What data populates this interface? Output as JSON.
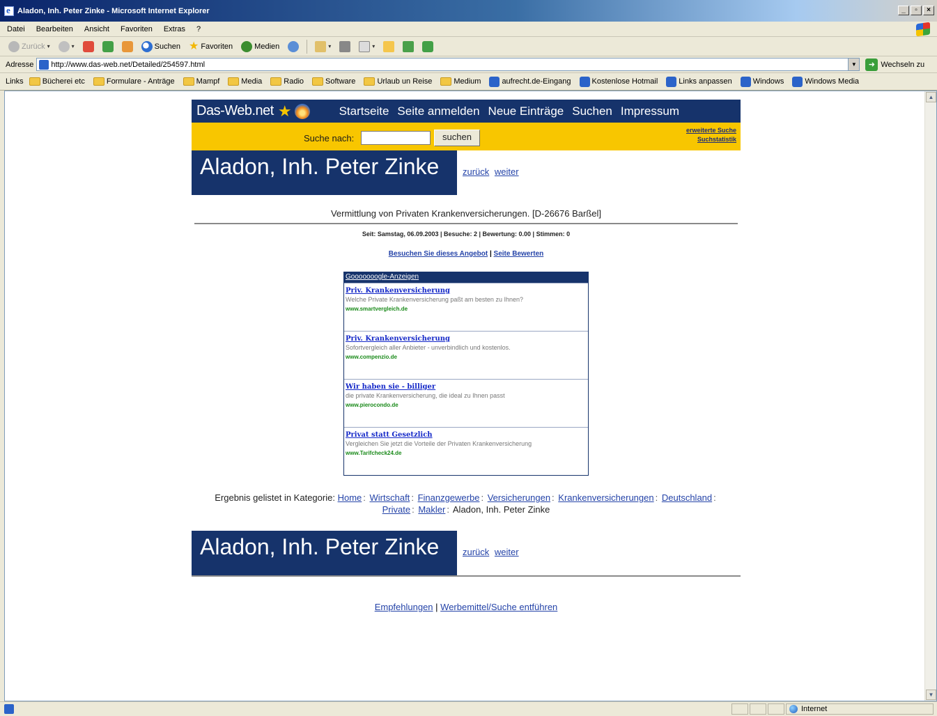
{
  "window": {
    "title": "Aladon, Inh. Peter Zinke - Microsoft Internet Explorer",
    "buttons": [
      "_",
      "▫",
      "×"
    ]
  },
  "menu": [
    "Datei",
    "Bearbeiten",
    "Ansicht",
    "Favoriten",
    "Extras",
    "?"
  ],
  "toolbar": {
    "back": "Zurück",
    "search": "Suchen",
    "favorites": "Favoriten",
    "media": "Medien"
  },
  "address": {
    "label": "Adresse",
    "url": "http://www.das-web.net/Detailed/254597.html",
    "go": "Wechseln zu"
  },
  "links": {
    "label": "Links",
    "items": [
      {
        "label": "Bücherei etc",
        "type": "folder"
      },
      {
        "label": "Formulare - Anträge",
        "type": "folder"
      },
      {
        "label": "Mampf",
        "type": "folder"
      },
      {
        "label": "Media",
        "type": "folder"
      },
      {
        "label": "Radio",
        "type": "folder"
      },
      {
        "label": "Software",
        "type": "folder"
      },
      {
        "label": "Urlaub un Reise",
        "type": "folder"
      },
      {
        "label": "Medium",
        "type": "folder"
      },
      {
        "label": "aufrecht.de-Eingang",
        "type": "page"
      },
      {
        "label": "Kostenlose Hotmail",
        "type": "page"
      },
      {
        "label": "Links anpassen",
        "type": "page"
      },
      {
        "label": "Windows",
        "type": "page"
      },
      {
        "label": "Windows Media",
        "type": "page"
      }
    ]
  },
  "site": {
    "logo": "Das-Web.net",
    "nav": [
      "Startseite",
      "Seite anmelden",
      "Neue Einträge",
      "Suchen",
      "Impressum"
    ],
    "search_label": "Suche nach:",
    "search_button": "suchen",
    "extended_search": "erweiterte Suche",
    "search_stats": "Suchstatistik"
  },
  "entry": {
    "title": "Aladon, Inh. Peter Zinke",
    "back": "zurück",
    "next": "weiter",
    "description": "Vermittlung von Privaten Krankenversicherungen. [D-26676 Barßel]",
    "meta": "Seit: Samstag, 06.09.2003 | Besuche: 2 | Bewertung: 0.00 | Stimmen: 0",
    "visit": "Besuchen Sie dieses Angebot",
    "rate": "Seite Bewerten",
    "category_prefix": "Ergebnis gelistet in Kategorie:",
    "categories": [
      "Home",
      "Wirtschaft",
      "Finanzgewerbe",
      "Versicherungen",
      "Krankenversicherungen",
      "Deutschland",
      "Private",
      "Makler"
    ],
    "category_current": "Aladon, Inh. Peter Zinke"
  },
  "ads": {
    "header": "Gooooooogle-Anzeigen",
    "items": [
      {
        "title": "Priv. Krankenversicherung",
        "text": "Welche Private Krankenversicherung paßt am besten zu Ihnen?",
        "url": "www.smartvergleich.de"
      },
      {
        "title": "Priv. Krankenversicherung",
        "text": "Sofortvergleich aller Anbieter - unverbindlich und kostenlos.",
        "url": "www.compenzio.de"
      },
      {
        "title": "Wir haben sie - billiger",
        "text": "die private Krankenversicherung, die ideal zu Ihnen passt",
        "url": "www.pierocondo.de"
      },
      {
        "title": "Privat statt Gesetzlich",
        "text": "Vergleichen Sie jetzt die Vorteile der Privaten Krankenversicherung",
        "url": "www.Tarifcheck24.de"
      }
    ]
  },
  "footer": {
    "recommend": "Empfehlungen",
    "promo": "Werbemittel/Suche entführen"
  },
  "status": {
    "zone": "Internet"
  }
}
